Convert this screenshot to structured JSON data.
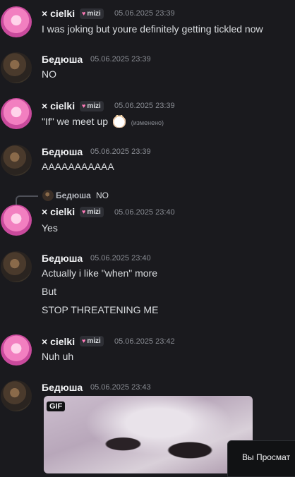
{
  "messages": [
    {
      "author": "× cielki",
      "badge": "mizi",
      "time": "05.06.2025 23:39",
      "lines": [
        "I was joking but youre definitely getting tickled now"
      ]
    },
    {
      "author": "Бедюша",
      "time": "05.06.2025 23:39",
      "lines": [
        "NO"
      ]
    },
    {
      "author": "× cielki",
      "badge": "mizi",
      "time": "05.06.2025 23:39",
      "lines": [
        "\"If\" we meet up"
      ],
      "edited": "(изменено)",
      "emoji": "cat-emoji"
    },
    {
      "author": "Бедюша",
      "time": "05.06.2025 23:39",
      "lines": [
        "AAAAAAAAAAA"
      ]
    },
    {
      "author": "× cielki",
      "badge": "mizi",
      "time": "05.06.2025 23:40",
      "lines": [
        "Yes"
      ],
      "reply": {
        "author": "Бедюша",
        "text": "NO"
      }
    },
    {
      "author": "Бедюша",
      "time": "05.06.2025 23:40",
      "lines": [
        "Actually i like \"when\" more",
        "But",
        "STOP THREATENING ME"
      ]
    },
    {
      "author": "× cielki",
      "badge": "mizi",
      "time": "05.06.2025 23:42",
      "lines": [
        "Nuh uh"
      ]
    },
    {
      "author": "Бедюша",
      "time": "05.06.2025 23:43",
      "gif_label": "GIF"
    }
  ],
  "toast": {
    "text": "Вы Просмат"
  },
  "colors": {
    "background": "#1a1a1e",
    "author": "#f2f3f5",
    "timestamp": "#8a8d94",
    "badge_heart": "#ff7ab8"
  }
}
